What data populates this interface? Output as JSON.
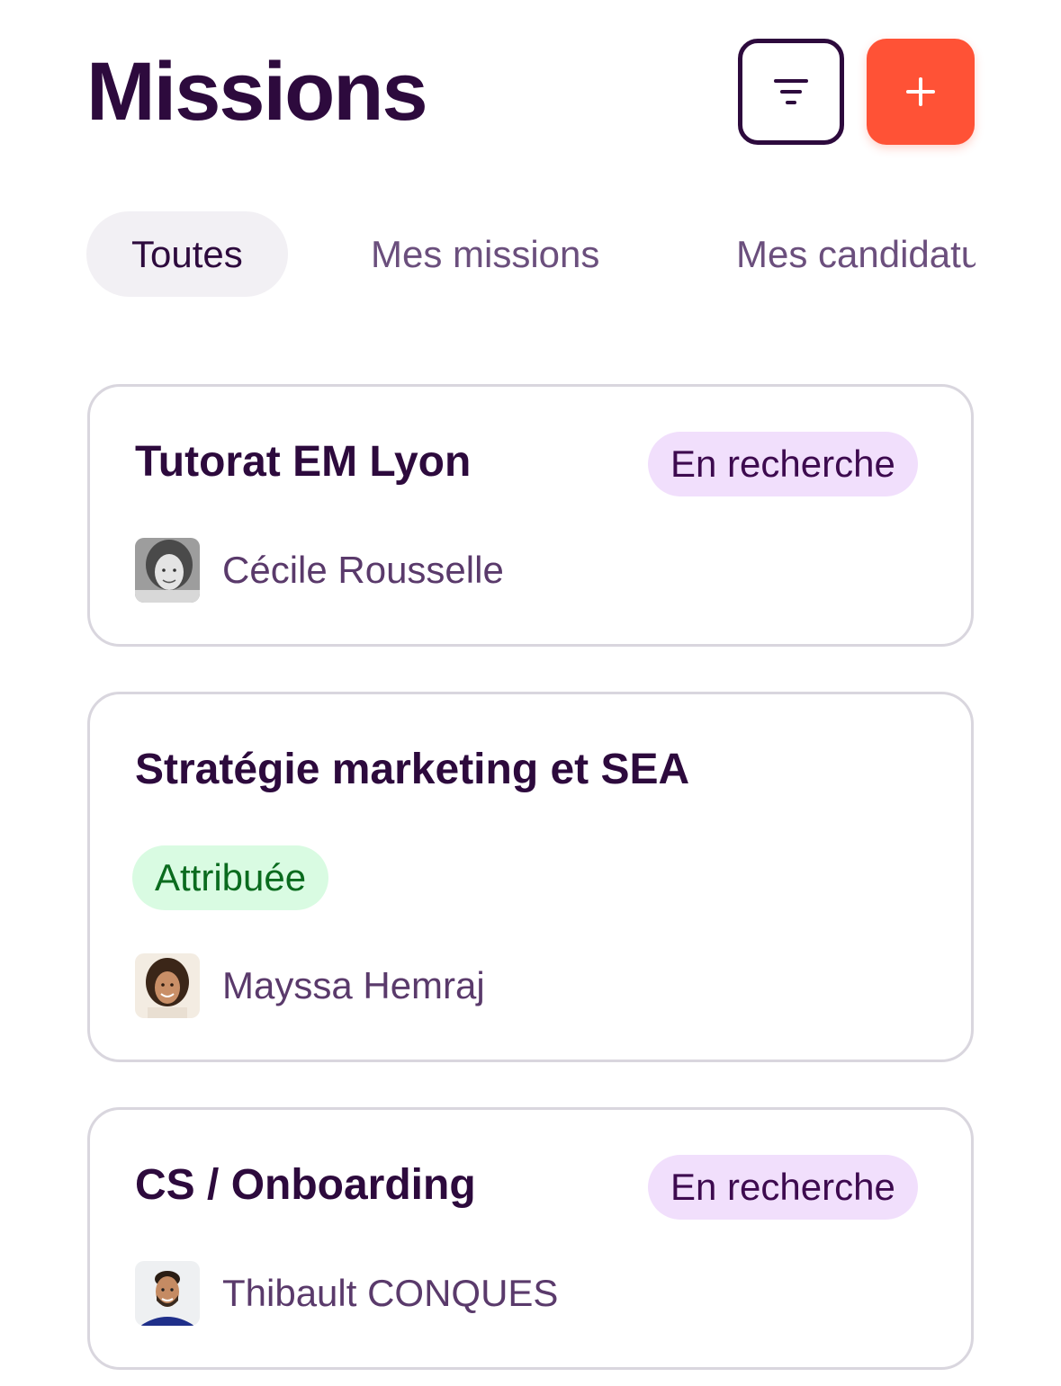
{
  "header": {
    "title": "Missions",
    "filter_icon": "filter-lines-icon",
    "add_icon": "plus-icon"
  },
  "tabs": [
    {
      "label": "Toutes",
      "active": true
    },
    {
      "label": "Mes missions",
      "active": false
    },
    {
      "label": "Mes candidatures",
      "active": false
    }
  ],
  "missions": [
    {
      "title": "Tutorat EM Lyon",
      "status": "En recherche",
      "owner": "Cécile Rousselle"
    },
    {
      "title": "Stratégie marketing et SEA",
      "status": "Attribuée",
      "owner": "Mayssa Hemraj"
    },
    {
      "title": "CS / Onboarding",
      "status": "En recherche",
      "owner": "Thibault CONQUES"
    }
  ],
  "colors": {
    "primary": "#2d0a3d",
    "accent": "#ff5236",
    "status_search_bg": "#f1dffc",
    "status_assigned_bg": "#d9fbe2",
    "status_assigned_text": "#0a6b1e"
  }
}
